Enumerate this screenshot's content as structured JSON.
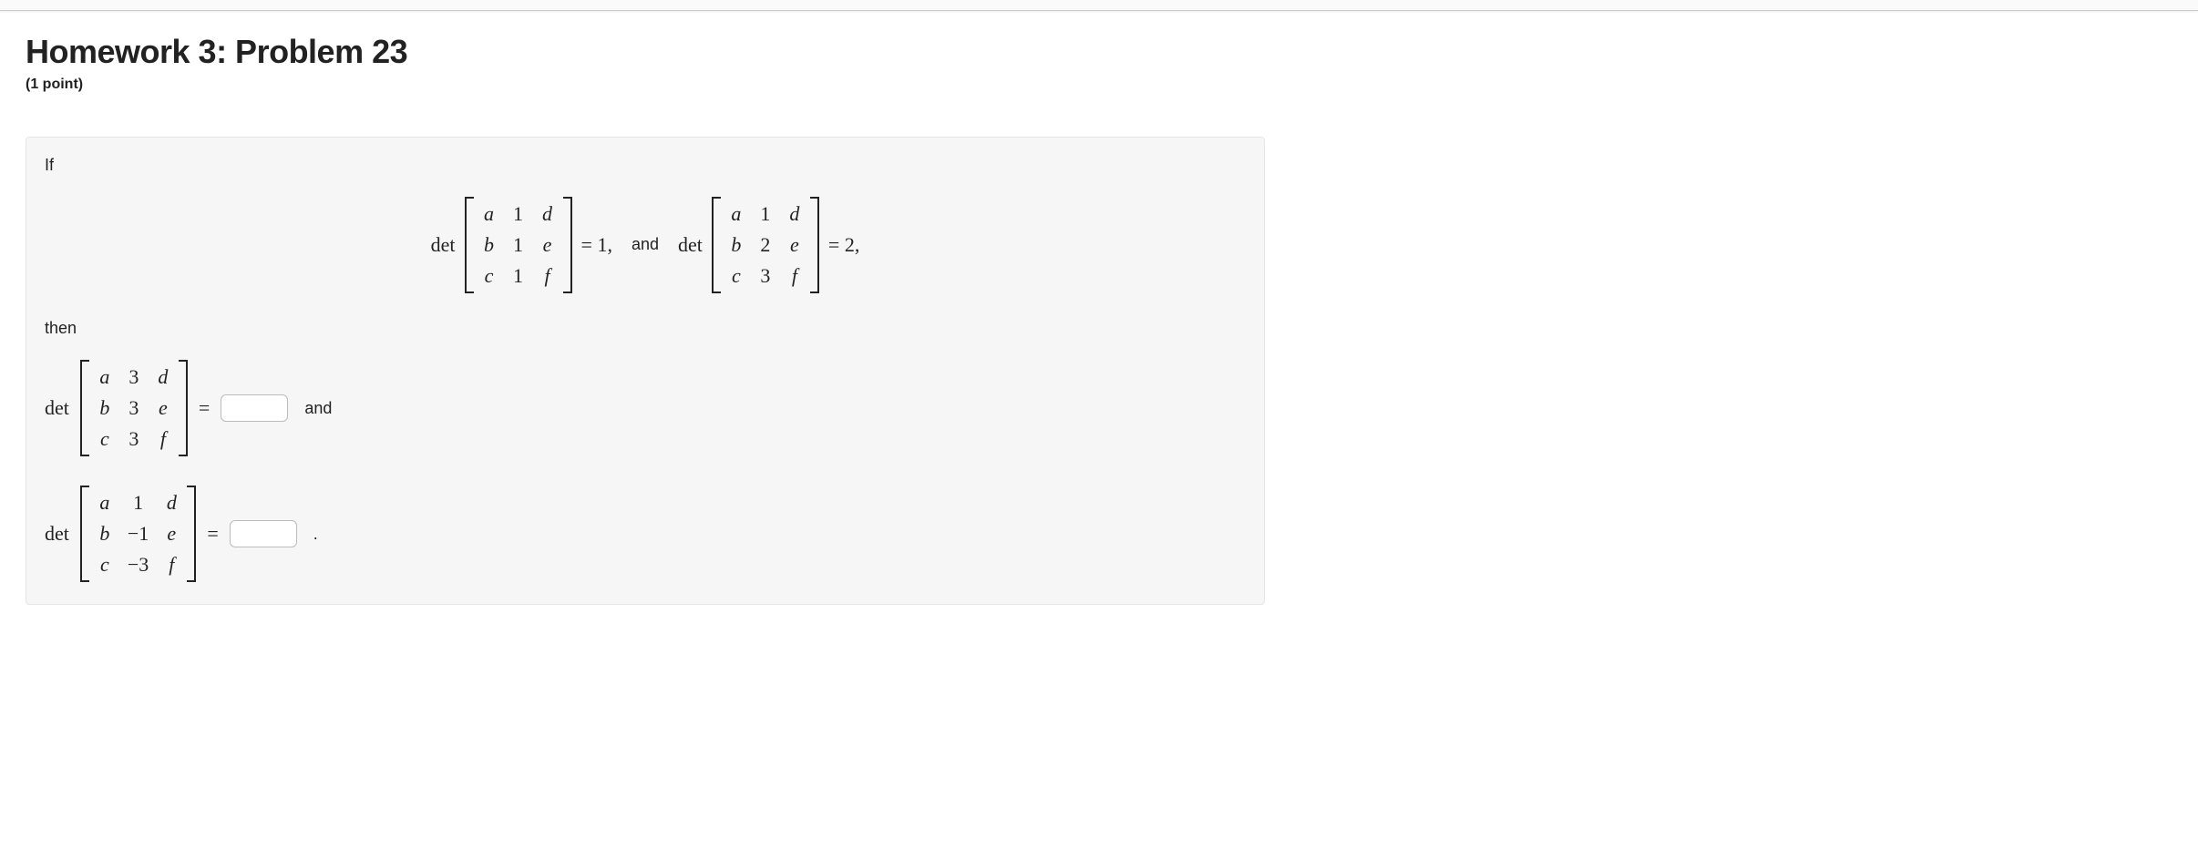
{
  "header": {
    "title": "Homework 3: Problem 23",
    "points": "(1 point)"
  },
  "text": {
    "if": "If",
    "then": "then",
    "and_word": "and",
    "and_comma": "and",
    "det": "det",
    "period": "."
  },
  "given": {
    "m1": {
      "rows": [
        [
          "a",
          "1",
          "d"
        ],
        [
          "b",
          "1",
          "e"
        ],
        [
          "c",
          "1",
          "f"
        ]
      ],
      "rhs": "= 1,"
    },
    "m2": {
      "rows": [
        [
          "a",
          "1",
          "d"
        ],
        [
          "b",
          "2",
          "e"
        ],
        [
          "c",
          "3",
          "f"
        ]
      ],
      "rhs": "= 2,"
    }
  },
  "answers": {
    "q1": {
      "rows": [
        [
          "a",
          "3",
          "d"
        ],
        [
          "b",
          "3",
          "e"
        ],
        [
          "c",
          "3",
          "f"
        ]
      ],
      "eq": "=",
      "value": ""
    },
    "q2": {
      "rows": [
        [
          "a",
          "1",
          "d"
        ],
        [
          "b",
          "−1",
          "e"
        ],
        [
          "c",
          "−3",
          "f"
        ]
      ],
      "eq": "=",
      "value": ""
    }
  }
}
